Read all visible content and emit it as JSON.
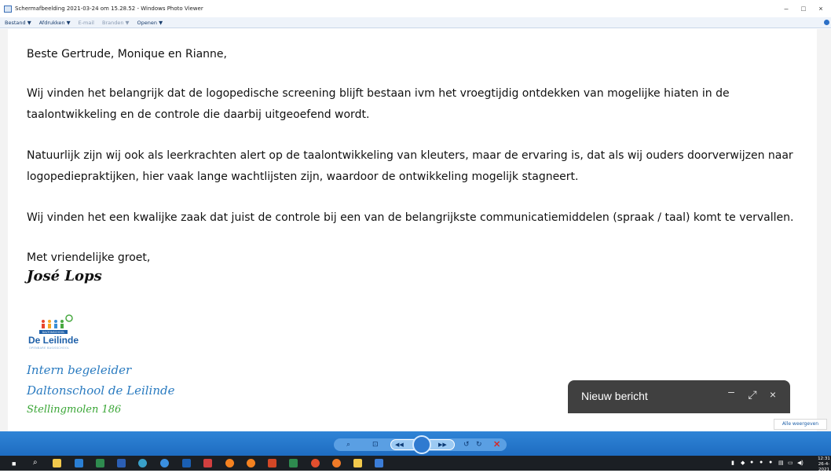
{
  "window": {
    "title": "Schermafbeelding 2021-03-24 om 15.28.52 - Windows Photo Viewer",
    "controls": [
      "–",
      "□",
      "×"
    ]
  },
  "menu": {
    "items": [
      "Bestand ▼",
      "Afdrukken ▼",
      "E-mail",
      "Branden ▼",
      "Openen ▼"
    ]
  },
  "letter": {
    "greeting": "Beste Gertrude, Monique en Rianne,",
    "p1_line1": "Wij vinden het belangrijk dat de logopedische screening blijft bestaan ivm het vroegtijdig ontdekken van mogelijke hiaten in de",
    "p1_line2": "taalontwikkeling en de controle die daarbij uitgeoefend wordt.",
    "p2_line1": "Natuurlijk zijn wij ook als leerkrachten alert op de taalontwikkeling van kleuters, maar de ervaring is, dat als wij ouders doorverwijzen naar",
    "p2_line2": "logopediepraktijken, hier vaak lange wachtlijsten zijn, waardoor de ontwikkeling mogelijk stagneert.",
    "p3": "Wij vinden het een kwalijke zaak dat juist de controle bij een van de belangrijkste communicatiemiddelen (spraak / taal) komt te vervallen.",
    "closing": "Met vriendelijke groet,",
    "signature": "José Lops"
  },
  "school": {
    "logo_badge": "DALTONSCHOOL",
    "logo_name": "De Leilinde",
    "logo_sub": "OPENBARE BASISSCHOOL",
    "role": "Intern begeleider",
    "name": "Daltonschool de Leilinde",
    "address": "Stellingmolen 186"
  },
  "compose": {
    "title": "Nieuw bericht",
    "minimize": "–",
    "expand": "⤢",
    "close": "×"
  },
  "notification": {
    "button": "Alle weergeven"
  },
  "toolbar": {
    "zoom": "⌕",
    "fit": "⊡",
    "prev": "◀◀",
    "next": "▶▶",
    "rotate_ccw": "↺",
    "rotate_cw": "↻",
    "delete": "✕"
  },
  "clock": {
    "time": "12:31",
    "date": "26-4-2021"
  }
}
